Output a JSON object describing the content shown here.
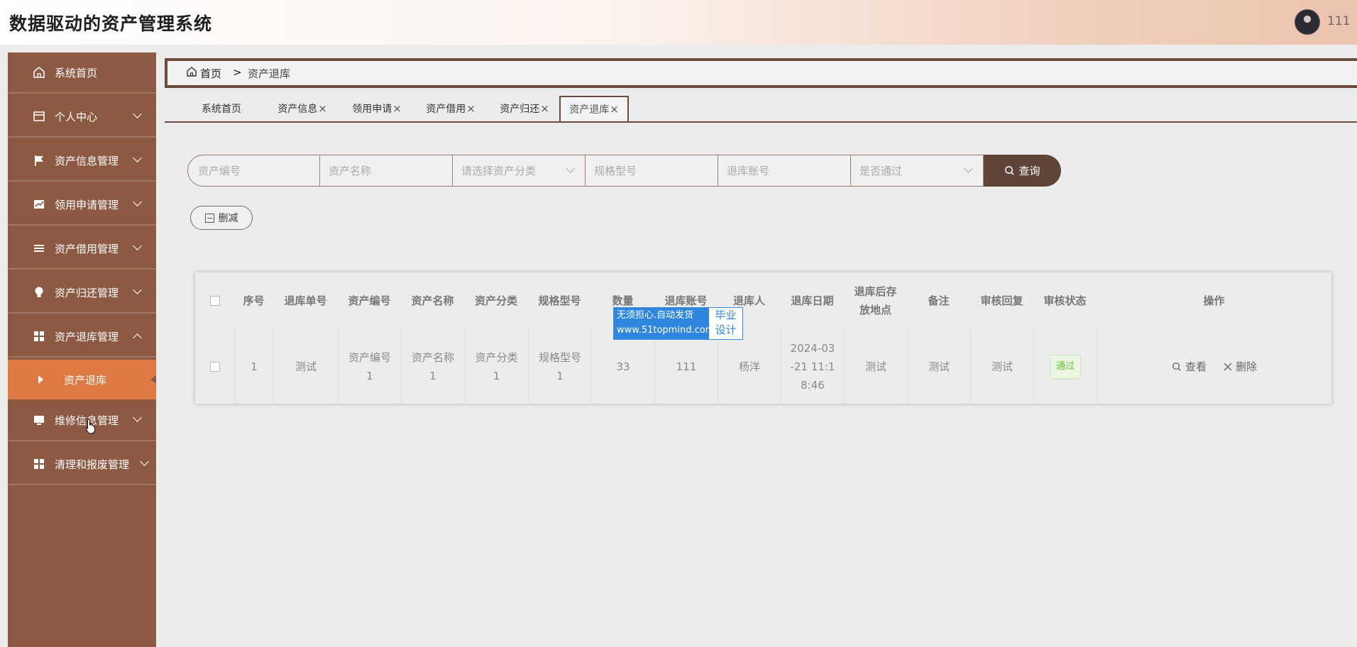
{
  "header": {
    "app_title": "数据驱动的资产管理系统",
    "user_name": "111"
  },
  "sidebar": {
    "items": [
      {
        "label": "系统首页",
        "icon": "home-icon"
      },
      {
        "label": "个人中心",
        "icon": "wallet-icon"
      },
      {
        "label": "资产信息管理",
        "icon": "flag-icon"
      },
      {
        "label": "领用申请管理",
        "icon": "chart-icon"
      },
      {
        "label": "资产借用管理",
        "icon": "list-icon"
      },
      {
        "label": "资产归还管理",
        "icon": "bulb-icon"
      },
      {
        "label": "资产退库管理",
        "icon": "grid-icon"
      },
      {
        "label": "维修信息管理",
        "icon": "monitor-icon"
      },
      {
        "label": "清理和报废管理",
        "icon": "grid-icon"
      }
    ],
    "sub_item": {
      "label": "资产退库"
    }
  },
  "breadcrumb": {
    "home": "首页",
    "separator": ">",
    "current": "资产退库"
  },
  "tabs": [
    {
      "label": "系统首页"
    },
    {
      "label": "资产信息"
    },
    {
      "label": "领用申请"
    },
    {
      "label": "资产借用"
    },
    {
      "label": "资产归还"
    },
    {
      "label": "资产退库"
    }
  ],
  "tab_close": "×",
  "search": {
    "asset_no_placeholder": "资产编号",
    "asset_name_placeholder": "资产名称",
    "category_placeholder": "请选择资产分类",
    "spec_placeholder": "规格型号",
    "account_placeholder": "退库账号",
    "pass_placeholder": "是否通过",
    "button_label": "查询"
  },
  "actions": {
    "delete_batch": "删减"
  },
  "table": {
    "headers": [
      "序号",
      "退库单号",
      "资产编号",
      "资产名称",
      "资产分类",
      "规格型号",
      "数量",
      "退库账号",
      "退库人",
      "退库日期",
      "退库后存放地点",
      "备注",
      "审核回复",
      "审核状态",
      "操作"
    ],
    "rows": [
      {
        "index": "1",
        "order_no": "测试",
        "asset_no": "资产编号1",
        "asset_name": "资产名称1",
        "category": "资产分类1",
        "spec": "规格型号1",
        "quantity": "33",
        "account": "111",
        "person": "杨洋",
        "date": "2024-03-21 11:18:46",
        "location": "测试",
        "remark": "测试",
        "reply": "测试",
        "status": "通过",
        "view_label": "查看",
        "delete_label": "删除"
      }
    ]
  },
  "watermark": {
    "line1": "无须担心.自动发货",
    "line2": "www.51topmind.com",
    "right1": "毕业",
    "right2": "设计"
  },
  "colors": {
    "sidebar": "#8c5a43",
    "active_menu": "#e07a45",
    "accent_dark": "#5f4438",
    "status_pass": "#67c23a"
  }
}
